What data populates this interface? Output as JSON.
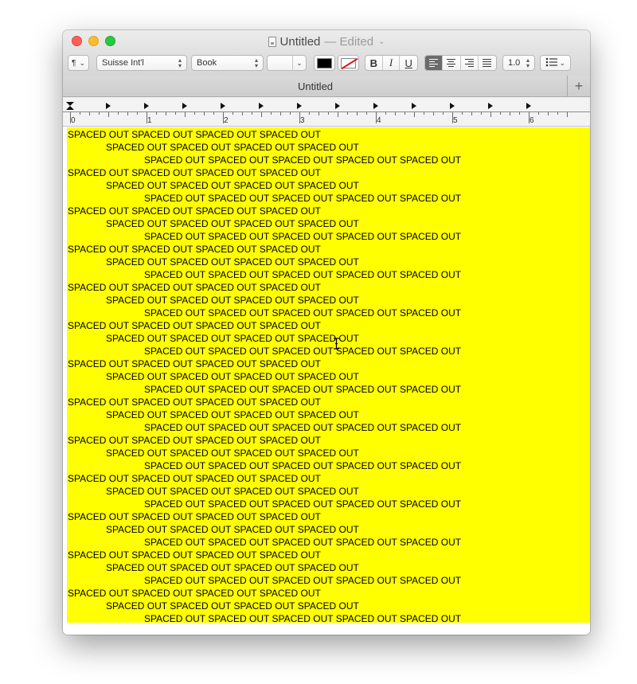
{
  "window": {
    "title": "Untitled",
    "status": "— Edited",
    "title_chevron": "⌄"
  },
  "toolbar": {
    "paragraph_style": "¶",
    "font_family": "Suisse Int'l",
    "typeface": "Book",
    "font_size": "",
    "text_color": "#000000",
    "bold_label": "B",
    "italic_label": "I",
    "underline_label": "U",
    "line_spacing": "1.0",
    "list_icon": "list-bullets-icon",
    "alignment_selected": "left"
  },
  "tabs": [
    {
      "label": "Untitled"
    }
  ],
  "tab_add_label": "+",
  "ruler": {
    "labels": [
      "0",
      "1",
      "2",
      "3",
      "4",
      "5",
      "6"
    ]
  },
  "document": {
    "background": "#ffff00",
    "line_patterns": [
      "SPACED OUT SPACED OUT SPACED OUT SPACED OUT",
      "SPACED OUT SPACED OUT SPACED OUT SPACED OUT",
      "SPACED OUT SPACED OUT SPACED OUT SPACED OUT SPACED OUT"
    ],
    "lines": [
      "SPACED OUT SPACED OUT SPACED OUT SPACED OUT",
      "SPACED OUT SPACED OUT SPACED OUT SPACED OUT",
      "SPACED OUT SPACED OUT SPACED OUT SPACED OUT SPACED OUT",
      "SPACED OUT SPACED OUT SPACED OUT SPACED OUT",
      "SPACED OUT SPACED OUT SPACED OUT SPACED OUT",
      "SPACED OUT SPACED OUT SPACED OUT SPACED OUT SPACED OUT",
      "SPACED OUT SPACED OUT SPACED OUT SPACED OUT",
      "SPACED OUT SPACED OUT SPACED OUT SPACED OUT",
      "SPACED OUT SPACED OUT SPACED OUT SPACED OUT SPACED OUT",
      "SPACED OUT SPACED OUT SPACED OUT SPACED OUT",
      "SPACED OUT SPACED OUT SPACED OUT SPACED OUT",
      "SPACED OUT SPACED OUT SPACED OUT SPACED OUT SPACED OUT",
      "SPACED OUT SPACED OUT SPACED OUT SPACED OUT",
      "SPACED OUT SPACED OUT SPACED OUT SPACED OUT",
      "SPACED OUT SPACED OUT SPACED OUT SPACED OUT SPACED OUT",
      "SPACED OUT SPACED OUT SPACED OUT SPACED OUT",
      "SPACED OUT SPACED OUT SPACED OUT SPACED OUT",
      "SPACED OUT SPACED OUT SPACED OUT SPACED OUT SPACED OUT",
      "SPACED OUT SPACED OUT SPACED OUT SPACED OUT",
      "SPACED OUT SPACED OUT SPACED OUT SPACED OUT",
      "SPACED OUT SPACED OUT SPACED OUT SPACED OUT SPACED OUT",
      "SPACED OUT SPACED OUT SPACED OUT SPACED OUT",
      "SPACED OUT SPACED OUT SPACED OUT SPACED OUT",
      "SPACED OUT SPACED OUT SPACED OUT SPACED OUT SPACED OUT",
      "SPACED OUT SPACED OUT SPACED OUT SPACED OUT",
      "SPACED OUT SPACED OUT SPACED OUT SPACED OUT",
      "SPACED OUT SPACED OUT SPACED OUT SPACED OUT SPACED OUT",
      "SPACED OUT SPACED OUT SPACED OUT SPACED OUT",
      "SPACED OUT SPACED OUT SPACED OUT SPACED OUT",
      "SPACED OUT SPACED OUT SPACED OUT SPACED OUT SPACED OUT",
      "SPACED OUT SPACED OUT SPACED OUT SPACED OUT",
      "SPACED OUT SPACED OUT SPACED OUT SPACED OUT",
      "SPACED OUT SPACED OUT SPACED OUT SPACED OUT SPACED OUT",
      "SPACED OUT SPACED OUT SPACED OUT SPACED OUT",
      "SPACED OUT SPACED OUT SPACED OUT SPACED OUT",
      "SPACED OUT SPACED OUT SPACED OUT SPACED OUT SPACED OUT",
      "SPACED OUT SPACED OUT SPACED OUT SPACED OUT",
      "SPACED OUT SPACED OUT SPACED OUT SPACED OUT",
      "SPACED OUT SPACED OUT SPACED OUT SPACED OUT SPACED OUT"
    ]
  }
}
